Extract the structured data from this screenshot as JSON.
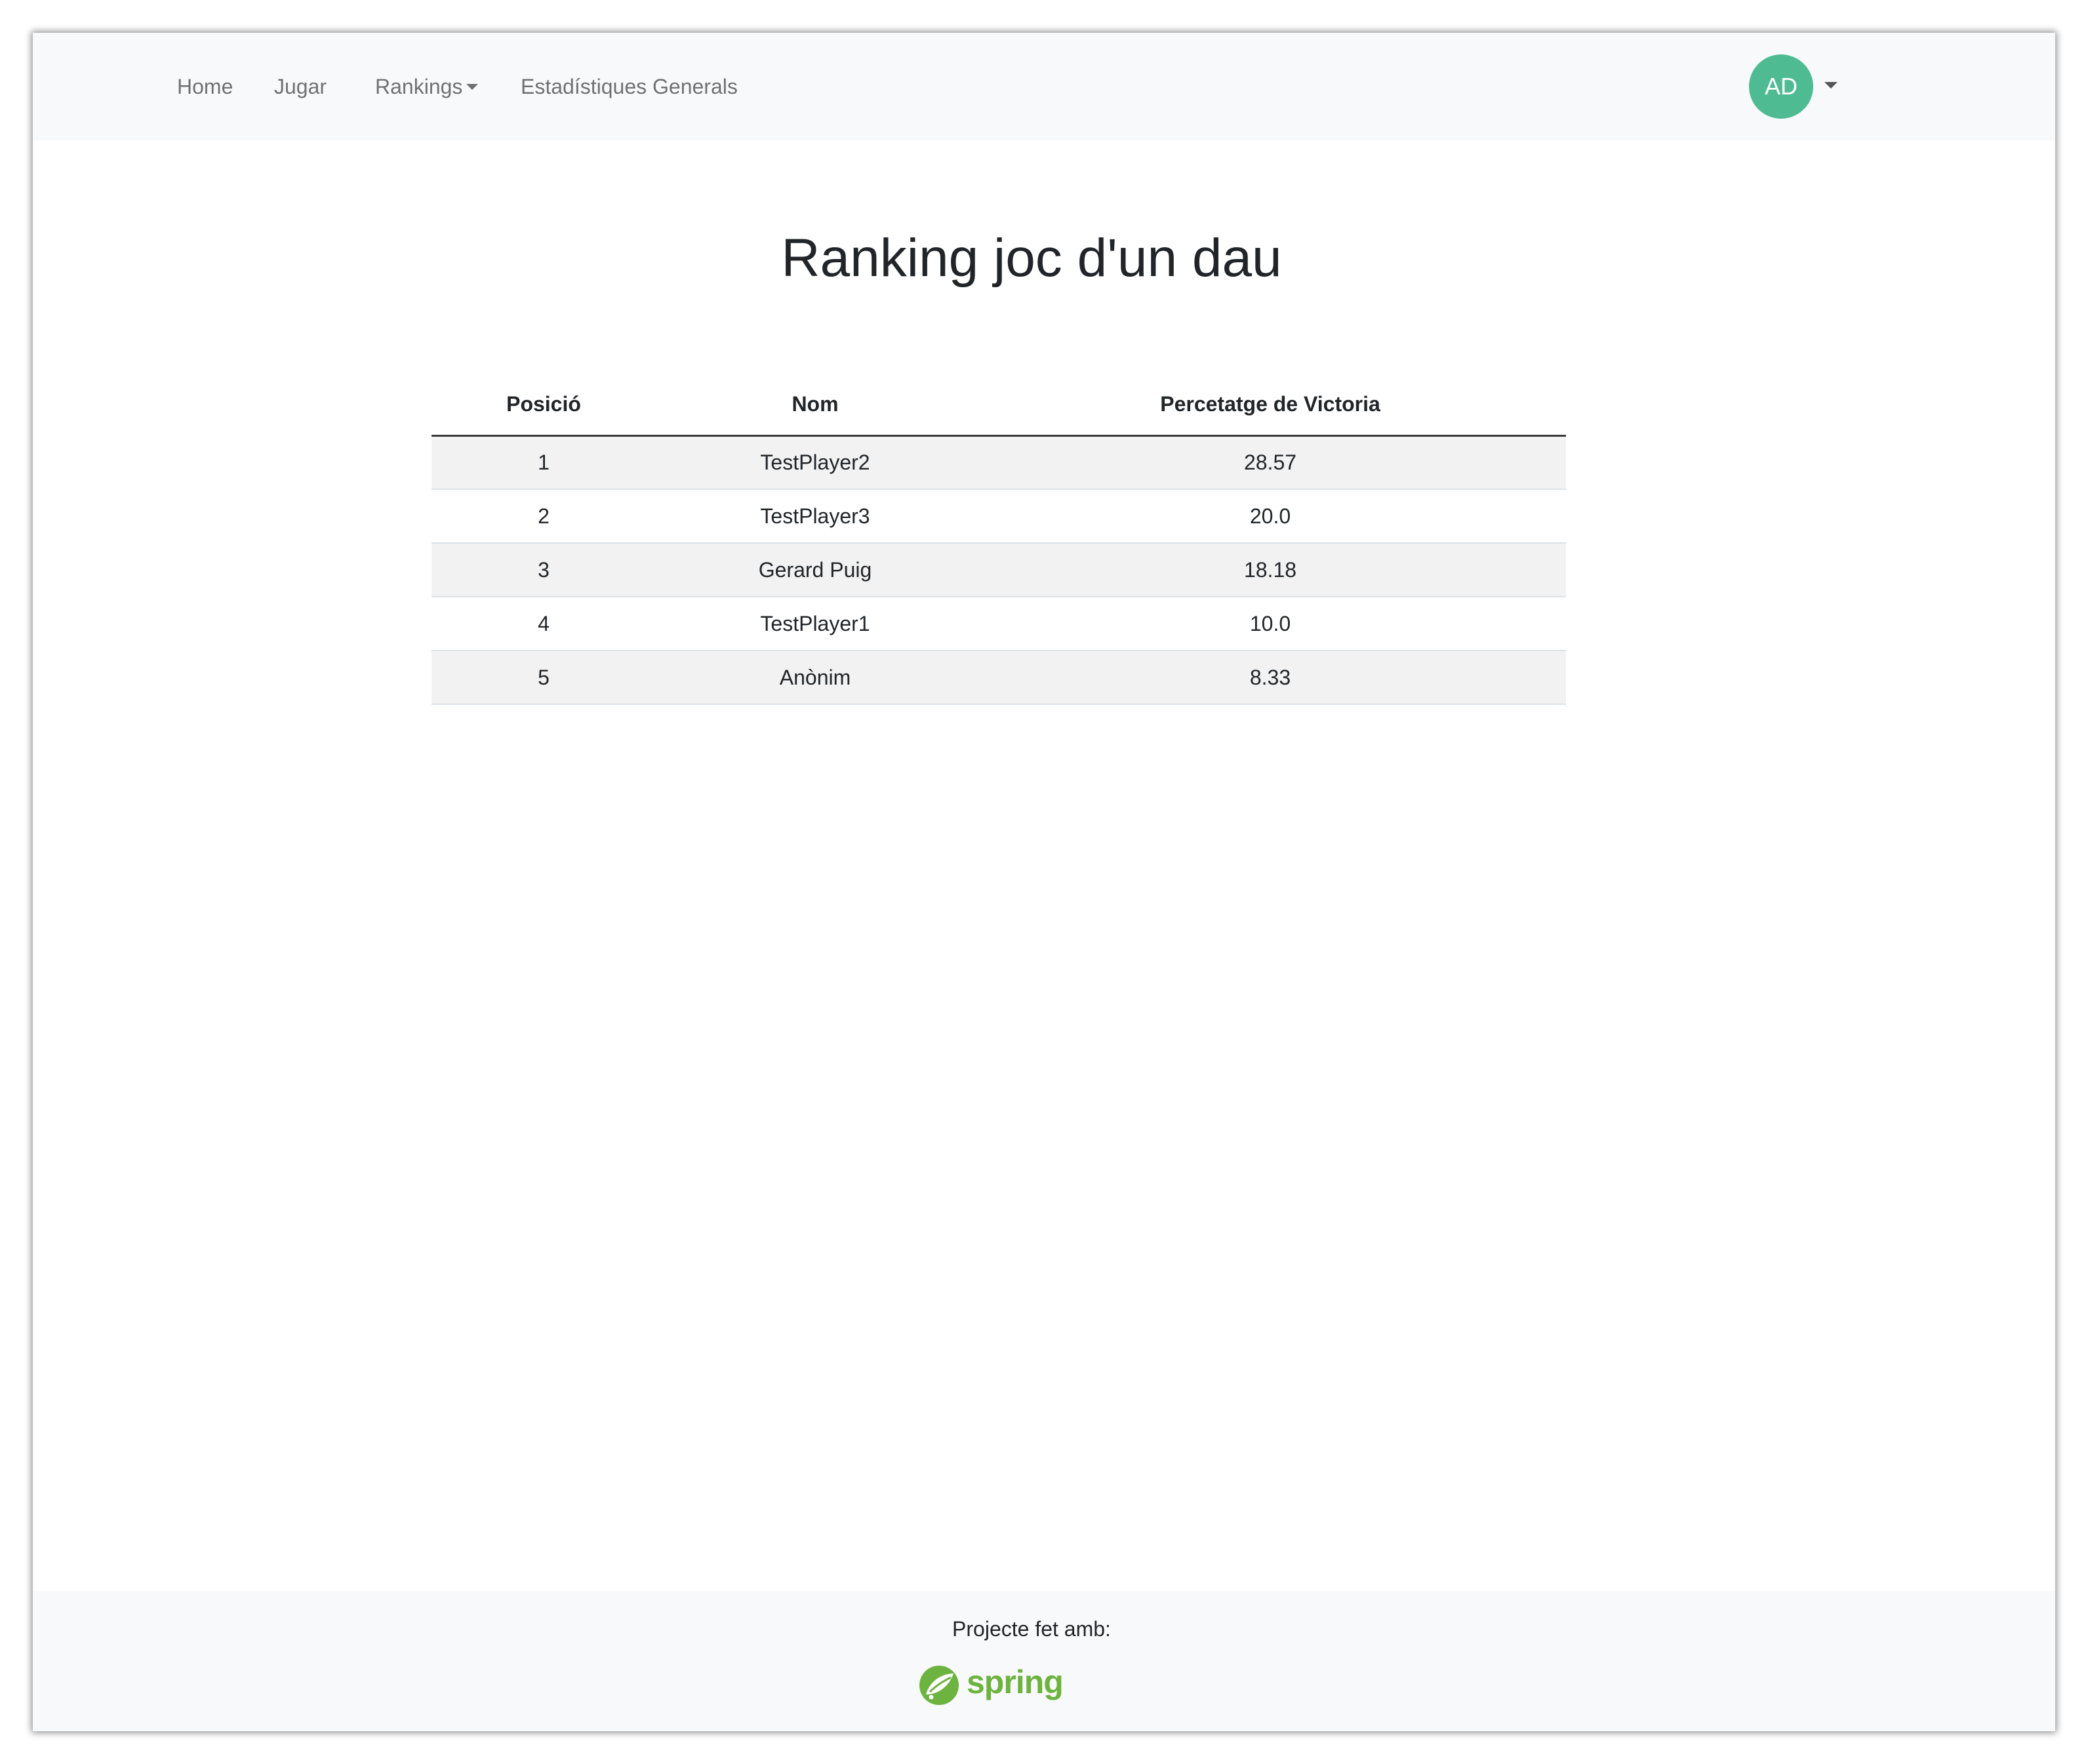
{
  "navbar": {
    "links": [
      {
        "label": "Home"
      },
      {
        "label": "Jugar"
      },
      {
        "label": "Rankings"
      },
      {
        "label": "Estadístiques Generals"
      }
    ],
    "user_initials": "AD",
    "avatar_color": "#4fbb93"
  },
  "page": {
    "title": "Ranking joc d'un dau"
  },
  "table": {
    "headers": [
      "Posició",
      "Nom",
      "Percetatge de Victoria"
    ],
    "rows": [
      [
        "1",
        "TestPlayer2",
        "28.57"
      ],
      [
        "2",
        "TestPlayer3",
        "20.0"
      ],
      [
        "3",
        "Gerard Puig",
        "18.18"
      ],
      [
        "4",
        "TestPlayer1",
        "10.0"
      ],
      [
        "5",
        "Anònim",
        "8.33"
      ]
    ]
  },
  "footer": {
    "text": "Projecte fet amb:",
    "logo_text": "spring",
    "logo_color": "#6db33f"
  }
}
